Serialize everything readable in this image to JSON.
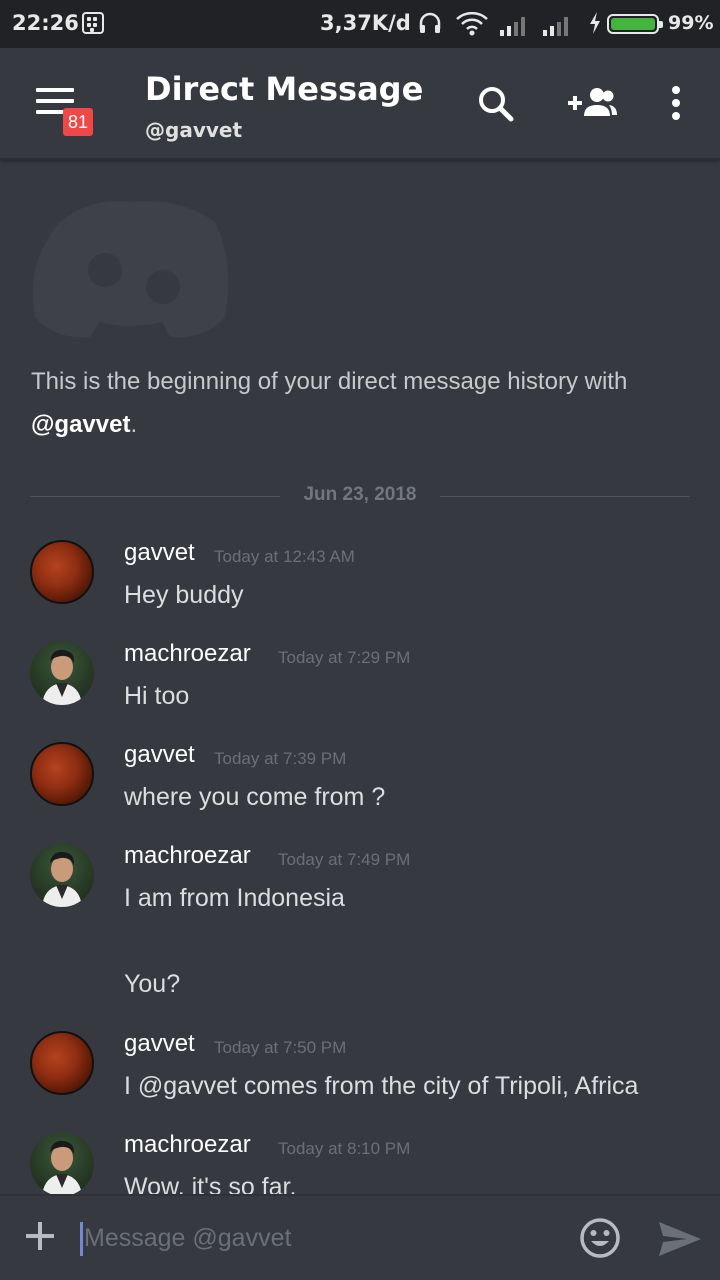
{
  "status_bar": {
    "time": "22:26",
    "net_speed": "3,37K/d",
    "battery_pct": "99%",
    "battery_level": 0.99,
    "icons": [
      "bbm-icon",
      "headphone-icon",
      "wifi-icon",
      "signal-icon",
      "signal-icon",
      "charging-icon",
      "battery-icon"
    ]
  },
  "header": {
    "title": "Direct Message",
    "subtitle": "@gavvet",
    "badge_count": "81",
    "icons": [
      "menu-icon",
      "search-icon",
      "add-friend-icon",
      "more-vertical-icon"
    ]
  },
  "intro": {
    "text": "This is the beginning of your direct message history with ",
    "mention": "@gavvet",
    "suffix": "."
  },
  "date_divider": "Jun 23, 2018",
  "messages": [
    {
      "user": "gavvet",
      "time": "Today at 12:43 AM",
      "lines": [
        "Hey buddy"
      ],
      "avatar": "moon"
    },
    {
      "user": "machroezar",
      "time": "Today at 7:29 PM",
      "lines": [
        "Hi too"
      ],
      "avatar": "person"
    },
    {
      "user": "gavvet",
      "time": "Today at 7:39 PM",
      "lines": [
        "where you come from ?"
      ],
      "avatar": "moon"
    },
    {
      "user": "machroezar",
      "time": "Today at 7:49 PM",
      "lines": [
        "I am from Indonesia",
        "You?"
      ],
      "avatar": "person"
    },
    {
      "user": "gavvet",
      "time": "Today at 7:50 PM",
      "lines": [
        "I @gavvet comes from the city of Tripoli, Africa"
      ],
      "avatar": "moon"
    },
    {
      "user": "machroezar",
      "time": "Today at 8:10 PM",
      "lines": [
        "Wow, it's so far."
      ],
      "avatar": "person"
    }
  ],
  "composer": {
    "placeholder": "Message @gavvet",
    "icons": [
      "plus-icon",
      "emoji-icon",
      "send-icon"
    ]
  },
  "colors": {
    "background": "#36393f",
    "status_bar": "#202225",
    "badge": "#f04747",
    "accent": "#7289da",
    "battery": "#43b53f"
  }
}
